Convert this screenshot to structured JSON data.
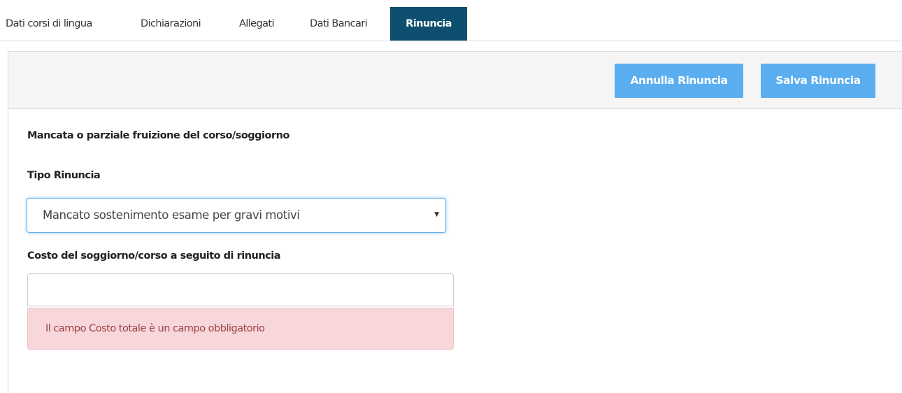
{
  "tabs": [
    {
      "label": "Dati corsi di lingua",
      "active": false
    },
    {
      "label": "Dichiarazioni",
      "active": false
    },
    {
      "label": "Allegati",
      "active": false
    },
    {
      "label": "Dati Bancari",
      "active": false
    },
    {
      "label": "Rinuncia",
      "active": true
    }
  ],
  "toolbar": {
    "cancel_label": "Annulla Rinuncia",
    "save_label": "Salva Rinuncia"
  },
  "form": {
    "section_title": "Mancata o parziale fruizione del corso/soggiorno",
    "tipo_label": "Tipo Rinuncia",
    "tipo_value": "Mancato sostenimento esame per gravi motivi",
    "costo_label": "Costo del soggiorno/corso a seguito di rinuncia",
    "costo_value": "",
    "error_message": "Il campo Costo totale è un campo obbligatorio"
  },
  "colors": {
    "active_tab": "#0e4f70",
    "button": "#5aaef0",
    "error_bg": "#f7d7da",
    "error_text": "#9b3f44"
  },
  "icons": {
    "select_arrow": "caret-down-icon"
  }
}
